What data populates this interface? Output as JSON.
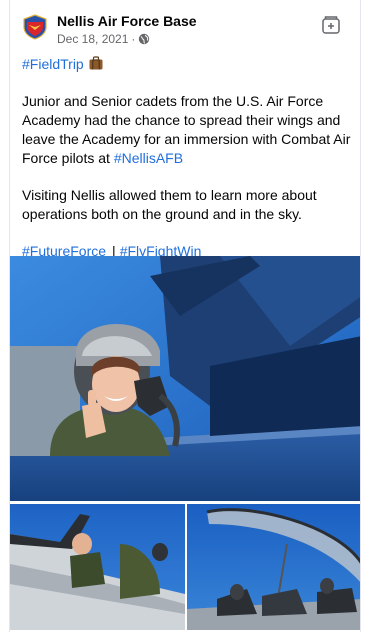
{
  "post": {
    "page_name": "Nellis Air Force Base",
    "date": "Dec 18, 2021",
    "date_separator": "·",
    "hashtag_fieldtrip": "#FieldTrip",
    "paragraph1_text": "Junior and Senior cadets from the U.S. Air Force Academy had the chance to spread their wings and leave the Academy for an immersion with Combat Air Force pilots at ",
    "hashtag_nellis": "#NellisAFB",
    "paragraph2": "Visiting Nellis allowed them to learn more about operations both on the ground and in the sky.",
    "hashtag_futureforce": "#FutureForce",
    "tag_separator": "|",
    "hashtag_flyfightwin": "#FlyFightWin"
  },
  "icons": {
    "avatar": "air-force-shield-icon",
    "privacy": "globe-icon",
    "save": "save-post-icon",
    "emoji": "luggage-icon"
  },
  "colors": {
    "link": "#216fdb",
    "meta": "#65676b",
    "sky": "#1f6fd1"
  }
}
